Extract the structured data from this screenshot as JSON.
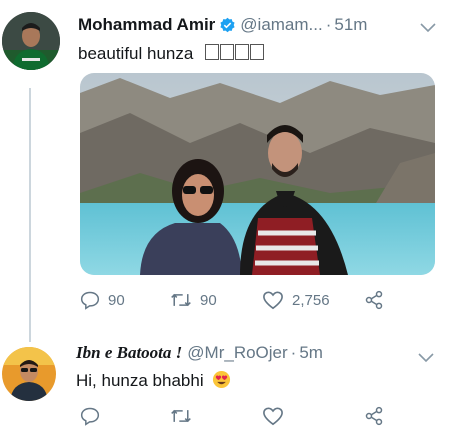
{
  "tweet": {
    "author_name": "Mohammad Amir",
    "handle": "@iamam...",
    "separator": "·",
    "time": "51m",
    "text": "beautiful  hunza",
    "replies": "90",
    "retweets": "90",
    "likes": "2,756"
  },
  "reply": {
    "author_name": "Ibn e Batoota !",
    "handle": "@Mr_RoOjer",
    "separator": "·",
    "time": "5m",
    "text": "Hi, hunza bhabhi"
  },
  "icons": {
    "reply": "reply-icon",
    "retweet": "retweet-icon",
    "like": "heart-icon",
    "share": "share-icon",
    "verified": "verified-badge-icon",
    "more": "chevron-down-icon",
    "emoji": "heart-eyes-emoji-icon"
  },
  "colors": {
    "name": "#14171a",
    "secondary": "#657786",
    "verified": "#1da1f2",
    "thread_line": "#ccd6dd"
  }
}
